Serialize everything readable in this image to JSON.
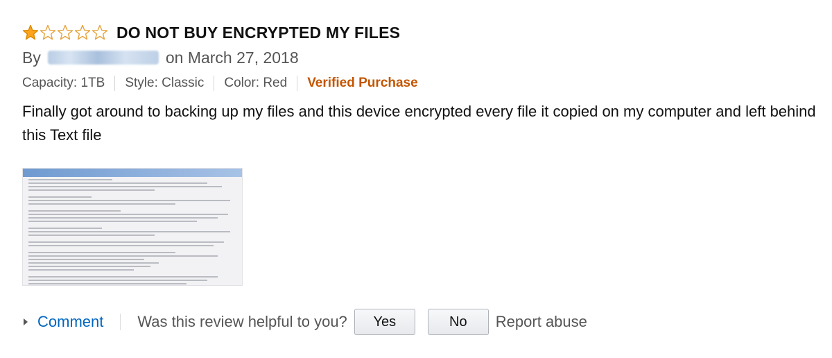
{
  "review": {
    "rating": 1,
    "max_rating": 5,
    "star_color": "#ffa41c",
    "title": "DO NOT BUY ENCRYPTED MY FILES",
    "by_prefix": "By",
    "date_text": "on March 27, 2018",
    "capacity": "Capacity: 1TB",
    "style": "Style: Classic",
    "color": "Color: Red",
    "verified": "Verified Purchase",
    "verified_color": "#c45500",
    "body": "Finally got around to backing up my files and this device encrypted every file it copied on my computer and left behind this Text file"
  },
  "actions": {
    "comment": "Comment",
    "helpful_question": "Was this review helpful to you?",
    "yes": "Yes",
    "no": "No",
    "report": "Report abuse"
  }
}
